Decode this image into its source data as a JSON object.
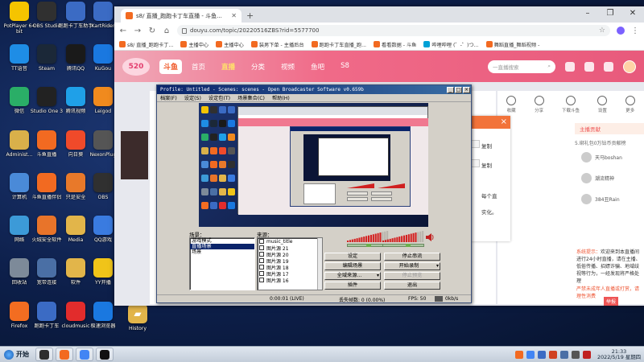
{
  "desktop": {
    "col1": [
      {
        "label": "PotPlayer 64 bit",
        "icon": "potplayer-icon",
        "color": "#f5c400"
      },
      {
        "label": "TT语音",
        "icon": "tt-voice-icon",
        "color": "#1e8de6"
      },
      {
        "label": "微信",
        "icon": "wechat-icon",
        "color": "#2aae67"
      },
      {
        "label": "Administ...",
        "icon": "user-folder-icon",
        "color": "#d9b04a"
      },
      {
        "label": "计算机",
        "icon": "computer-icon",
        "color": "#4a8ad8"
      },
      {
        "label": "网络",
        "icon": "network-icon",
        "color": "#3c9ad8"
      },
      {
        "label": "回收站",
        "icon": "recycle-bin-icon",
        "color": "#7d8a99"
      },
      {
        "label": "Firefox",
        "icon": "firefox-icon",
        "color": "#f36d21"
      }
    ],
    "col2": [
      {
        "label": "OBS Studio",
        "icon": "obs-icon",
        "color": "#303030"
      },
      {
        "label": "Steam",
        "icon": "steam-icon",
        "color": "#1b2838"
      },
      {
        "label": "Studio One 3",
        "icon": "studio-one-icon",
        "color": "#222222"
      },
      {
        "label": "斗鱼直播",
        "icon": "douyu-icon",
        "color": "#f26a21"
      },
      {
        "label": "斗鱼直播伴侣",
        "icon": "douyu-companion-icon",
        "color": "#f26a21"
      },
      {
        "label": "火绒安全软件",
        "icon": "huorong-icon",
        "color": "#e8742a"
      },
      {
        "label": "宽带连接",
        "icon": "broadband-icon",
        "color": "#4a6fa5"
      },
      {
        "label": "跑跑卡丁车",
        "icon": "kartrider-icon",
        "color": "#3b6bc4"
      }
    ],
    "col3": [
      {
        "label": "跑跑卡丁车助手",
        "icon": "kart-helper-icon",
        "color": "#3b6bc4"
      },
      {
        "label": "腾讯QQ",
        "icon": "qq-icon",
        "color": "#1a1a1a"
      },
      {
        "label": "腾讯视频",
        "icon": "tencent-video-icon",
        "color": "#1fa0e8"
      },
      {
        "label": "向日葵",
        "icon": "sunflower-icon",
        "color": "#f04a2a"
      },
      {
        "label": "只是安全",
        "icon": "shield-app-icon",
        "color": "#e8792a"
      },
      {
        "label": "Media",
        "icon": "folder-icon",
        "color": "#e2b54a"
      },
      {
        "label": "软件",
        "icon": "folder-icon",
        "color": "#e2b54a"
      },
      {
        "label": "cloudmusic",
        "icon": "cloudmusic-icon",
        "color": "#e22c2c"
      }
    ],
    "col4": [
      {
        "label": "KartRider",
        "icon": "kartrider-game-icon",
        "color": "#3b6bc4"
      },
      {
        "label": "KuGou",
        "icon": "kugou-icon",
        "color": "#1a78e0"
      },
      {
        "label": "Leigod",
        "icon": "leigod-icon",
        "color": "#f08a1e"
      },
      {
        "label": "NexonPlug",
        "icon": "nexon-icon",
        "color": "#555555"
      },
      {
        "label": "OBS",
        "icon": "obs-icon",
        "color": "#303030"
      },
      {
        "label": "QQ游戏",
        "icon": "qq-game-icon",
        "color": "#3a7be0"
      },
      {
        "label": "YY开播",
        "icon": "yy-icon",
        "color": "#f0c419"
      },
      {
        "label": "极速浏览器",
        "icon": "browser-app-icon",
        "color": "#1a78e0"
      }
    ],
    "extra": {
      "label": "History",
      "icon": "folder-icon",
      "color": "#e2b54a"
    }
  },
  "taskbar": {
    "start_label": "开始",
    "apps": [
      {
        "icon": "obs-taskbar-icon",
        "color": "#2d2d2d"
      },
      {
        "icon": "douyu-taskbar-icon",
        "color": "#f26a21"
      },
      {
        "icon": "chrome-taskbar-icon",
        "color": "#4285f4"
      },
      {
        "icon": "obs-classic-taskbar-icon",
        "color": "#111111"
      }
    ],
    "tray_icons": [
      {
        "icon": "tray-douyu-icon",
        "color": "#f26a21"
      },
      {
        "icon": "tray-chrome-icon",
        "color": "#4285f4"
      },
      {
        "icon": "tray-user-icon",
        "color": "#3b6bc4"
      },
      {
        "icon": "tray-shield-icon",
        "color": "#d04020"
      },
      {
        "icon": "tray-network-icon",
        "color": "#4a6fa5"
      },
      {
        "icon": "tray-volume-icon",
        "color": "#555555"
      },
      {
        "icon": "tray-ime-icon",
        "color": "#c02020"
      }
    ],
    "time": "21:33",
    "date": "2022/5/19 星期四"
  },
  "browser": {
    "tab_title": "s8/ 直播_跑跑卡丁车直播 - 斗鱼...",
    "url": "douyu.com/topic/20220516ZBS?rid=5577700",
    "bookmarks": [
      {
        "label": "s8/ 直播_跑跑卡丁...",
        "color": "#f26a21"
      },
      {
        "label": "主播中心",
        "color": "#f26a21"
      },
      {
        "label": "主播中心",
        "color": "#f26a21"
      },
      {
        "label": "装男下单 - 主播后台",
        "color": "#f26a21"
      },
      {
        "label": "跑跑卡丁车直播_跑...",
        "color": "#f26a21"
      },
      {
        "label": "看看数据 - 斗鱼",
        "color": "#f26a21"
      },
      {
        "label": "哔哩哔哩 (゜-゜)つ...",
        "color": "#00a1d6"
      },
      {
        "label": "舞蹈直播_舞蹈视频 -",
        "color": "#f26a21"
      }
    ]
  },
  "site": {
    "badge": "520",
    "logo": "斗鱼",
    "nav": [
      "首页",
      "直播",
      "分类",
      "视频",
      "鱼吧",
      "S8"
    ],
    "active_nav": 1,
    "search_placeholder": "一直播搜索"
  },
  "side": {
    "tools": [
      "收藏",
      "分享",
      "下载斗鱼",
      "设置",
      "更多"
    ],
    "rank_tab": "主播贡献",
    "rank_line": "5.绑礼包0万钻币贡献榜",
    "viewers": [
      "天马boshan",
      "潮流精神",
      "384丑Rain"
    ],
    "notice_label": "系统提示：",
    "notice_text": "欢迎来到本直播间进行24小时直播，请在主播、低俗传播、招嫖诈骗、地域歧视等行为，一经发现将严格处理",
    "announce": "严禁未成年人直播或打赏，请理性消费",
    "report": "举报"
  },
  "popup": {
    "close": "×",
    "line1": "复制",
    "line2": "复制",
    "line3": "每个直",
    "line4": "实化。"
  },
  "obs": {
    "title": "Profile: Untitled - Scenes: scenes - Open Broadcaster Software v0.659b",
    "menu": [
      "档案(F)",
      "设定(S)",
      "设定包(T)",
      "场景集合(C)",
      "帮助(H)"
    ],
    "scenes_label": "场景：",
    "sources_label": "来源：",
    "scenes": [
      "游戏模式",
      "直播场景",
      "场景"
    ],
    "selected_scene": 1,
    "sources": [
      "music_title",
      "图片源 21",
      "图片源 20",
      "图片源 19",
      "图片源 18",
      "图片源 17",
      "图片源 16"
    ],
    "buttons": {
      "settings": "设定",
      "stop_stream": "停止串流",
      "edit_scene": "编辑场景",
      "start_recording": "开始录制",
      "global_sources": "全域来源...",
      "preview": "停止预览",
      "plugins": "插件",
      "exit": "退出"
    },
    "status": {
      "time": "0:00:01 (LIVE)",
      "dropped": "丢失帧数: 0 (0.00%)",
      "fps": "FPS: 50",
      "bitrate": "0kb/s"
    },
    "meter_level_mic": 0.78,
    "meter_level_desktop": 0.82,
    "volume_mic": 0.5,
    "volume_desktop": 0.6
  }
}
